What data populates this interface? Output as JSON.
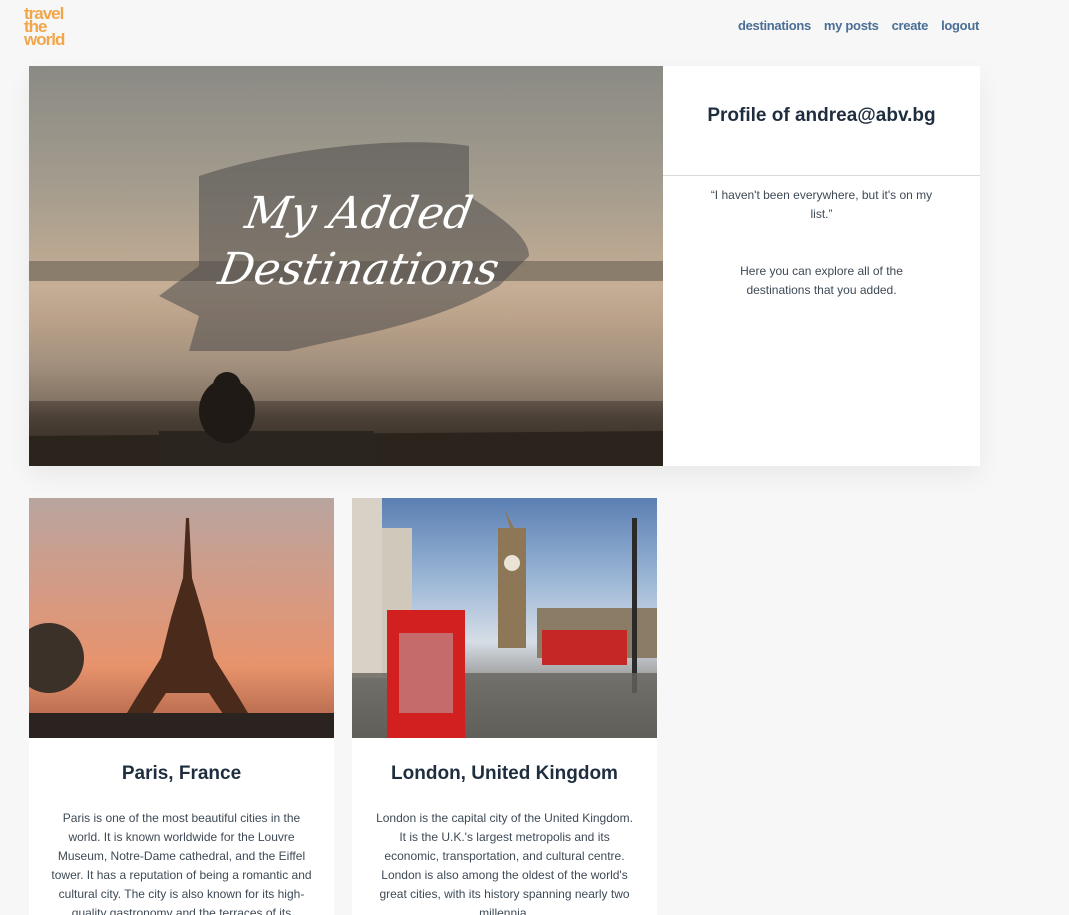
{
  "header": {
    "logo_lines": [
      "travel",
      "the",
      "world"
    ],
    "nav": [
      "destinations",
      "my posts",
      "create",
      "logout"
    ]
  },
  "hero": {
    "title_line1": "My Added",
    "title_line2": "Destinations"
  },
  "profile": {
    "title": "Profile of andrea@abv.bg",
    "quote": "“I haven't been everywhere, but it's on my list.”",
    "description": "Here you can explore all of the destinations that you added."
  },
  "cards": [
    {
      "title": "Paris, France",
      "text": "Paris is one of the most beautiful cities in the world. It is known worldwide for the Louvre Museum, Notre-Dame cathedral, and the Eiffel tower. It has a reputation of being a romantic and cultural city. The city is also known for its high-quality gastronomy and the terraces of its"
    },
    {
      "title": "London, United Kingdom",
      "text": "London is the capital city of the United Kingdom. It is the U.K.'s largest metropolis and its economic, transportation, and cultural centre. London is also among the oldest of the world's great cities, with its history spanning nearly two millennia."
    }
  ],
  "colors": {
    "accent_logo": "#f2a64a",
    "nav_link": "#4a6e96",
    "heading": "#1f2e3f"
  }
}
